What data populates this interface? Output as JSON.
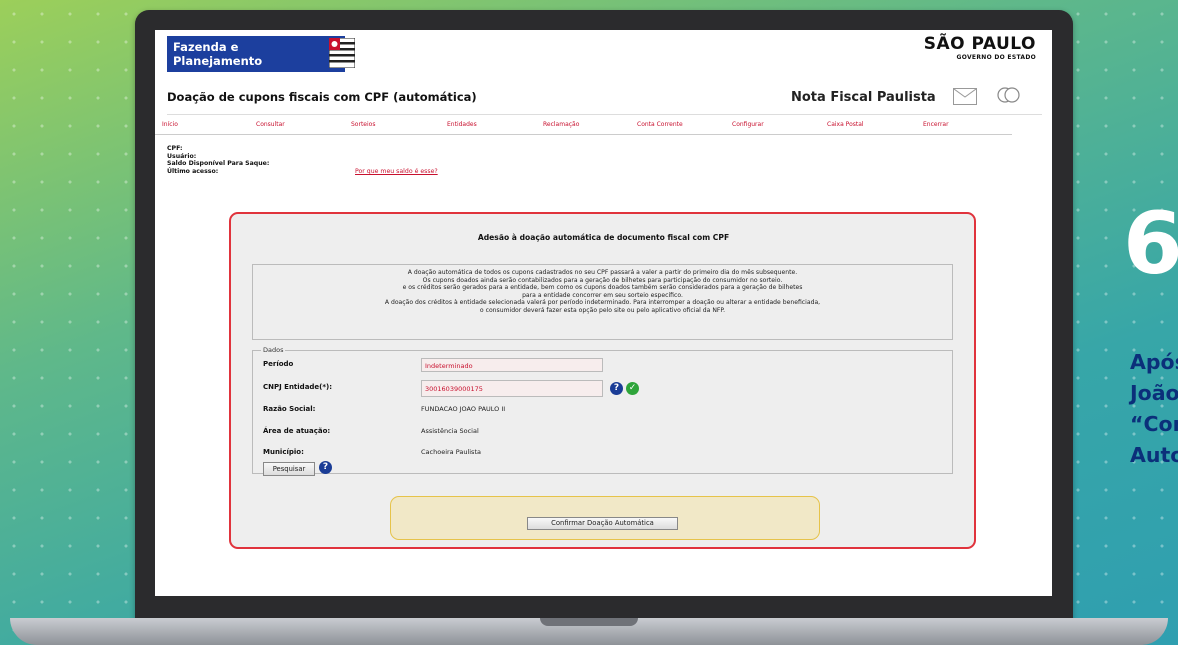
{
  "header": {
    "brand_line1": "Fazenda e",
    "brand_line2": "Planejamento",
    "sp_logo": "SÃO PAULO",
    "sp_logo_sub": "GOVERNO DO ESTADO"
  },
  "titlebar": {
    "page_title": "Doação de cupons fiscais com CPF (automática)",
    "app_name": "Nota Fiscal Paulista"
  },
  "menu": [
    {
      "label": "Início"
    },
    {
      "label": "Consultar"
    },
    {
      "label": "Sorteios"
    },
    {
      "label": "Entidades"
    },
    {
      "label": "Reclamação"
    },
    {
      "label": "Conta Corrente"
    },
    {
      "label": "Configurar"
    },
    {
      "label": "Caixa Postal"
    },
    {
      "label": "Encerrar"
    }
  ],
  "user_info": {
    "cpf_label": "CPF:",
    "usuario_label": "Usuário:",
    "saldo_label": "Saldo Disponível Para Saque:",
    "ultimo_acesso_label": "Último acesso:",
    "saldo_link": "Por que meu saldo é esse?"
  },
  "panel": {
    "title": "Adesão à doação automática de documento fiscal com CPF",
    "description_lines": [
      "A doação automática de todos os cupons cadastrados no seu CPF passará a valer a partir do primeiro dia do mês subsequente.",
      "Os cupons doados ainda serão contabilizados para a geração de bilhetes para participação do consumidor no sorteio.",
      "e os créditos serão gerados para a entidade, bem como os cupons doados também serão considerados para a geração de bilhetes",
      "para a entidade concorrer em seu sorteio específico.",
      "A doação dos créditos à entidade selecionada valerá por período indeterminado. Para interromper a doação ou alterar a entidade beneficiada,",
      "o consumidor deverá fazer esta opção pelo site ou pelo aplicativo oficial da NFP."
    ],
    "fieldset_legend": "Dados",
    "fields": {
      "periodo_label": "Período",
      "periodo_value": "Indeterminado",
      "cnpj_label": "CNPJ Entidade(*):",
      "cnpj_value": "30016039000175",
      "razao_label": "Razão Social:",
      "razao_value": "FUNDACAO JOAO PAULO II",
      "area_label": "Área de atuação:",
      "area_value": "Assistência Social",
      "municipio_label": "Município:",
      "municipio_value": "Cachoeira Paulista"
    },
    "search_button": "Pesquisar",
    "confirm_button": "Confirmar Doação Automática"
  },
  "side": {
    "step_number": "6",
    "lines": [
      "Após",
      "João",
      "“Con",
      "Auto"
    ]
  },
  "colors": {
    "brand_blue": "#1c3f9e",
    "menu_red": "#c8102e",
    "panel_border": "#e0333c",
    "side_text": "#0b2f7a"
  }
}
